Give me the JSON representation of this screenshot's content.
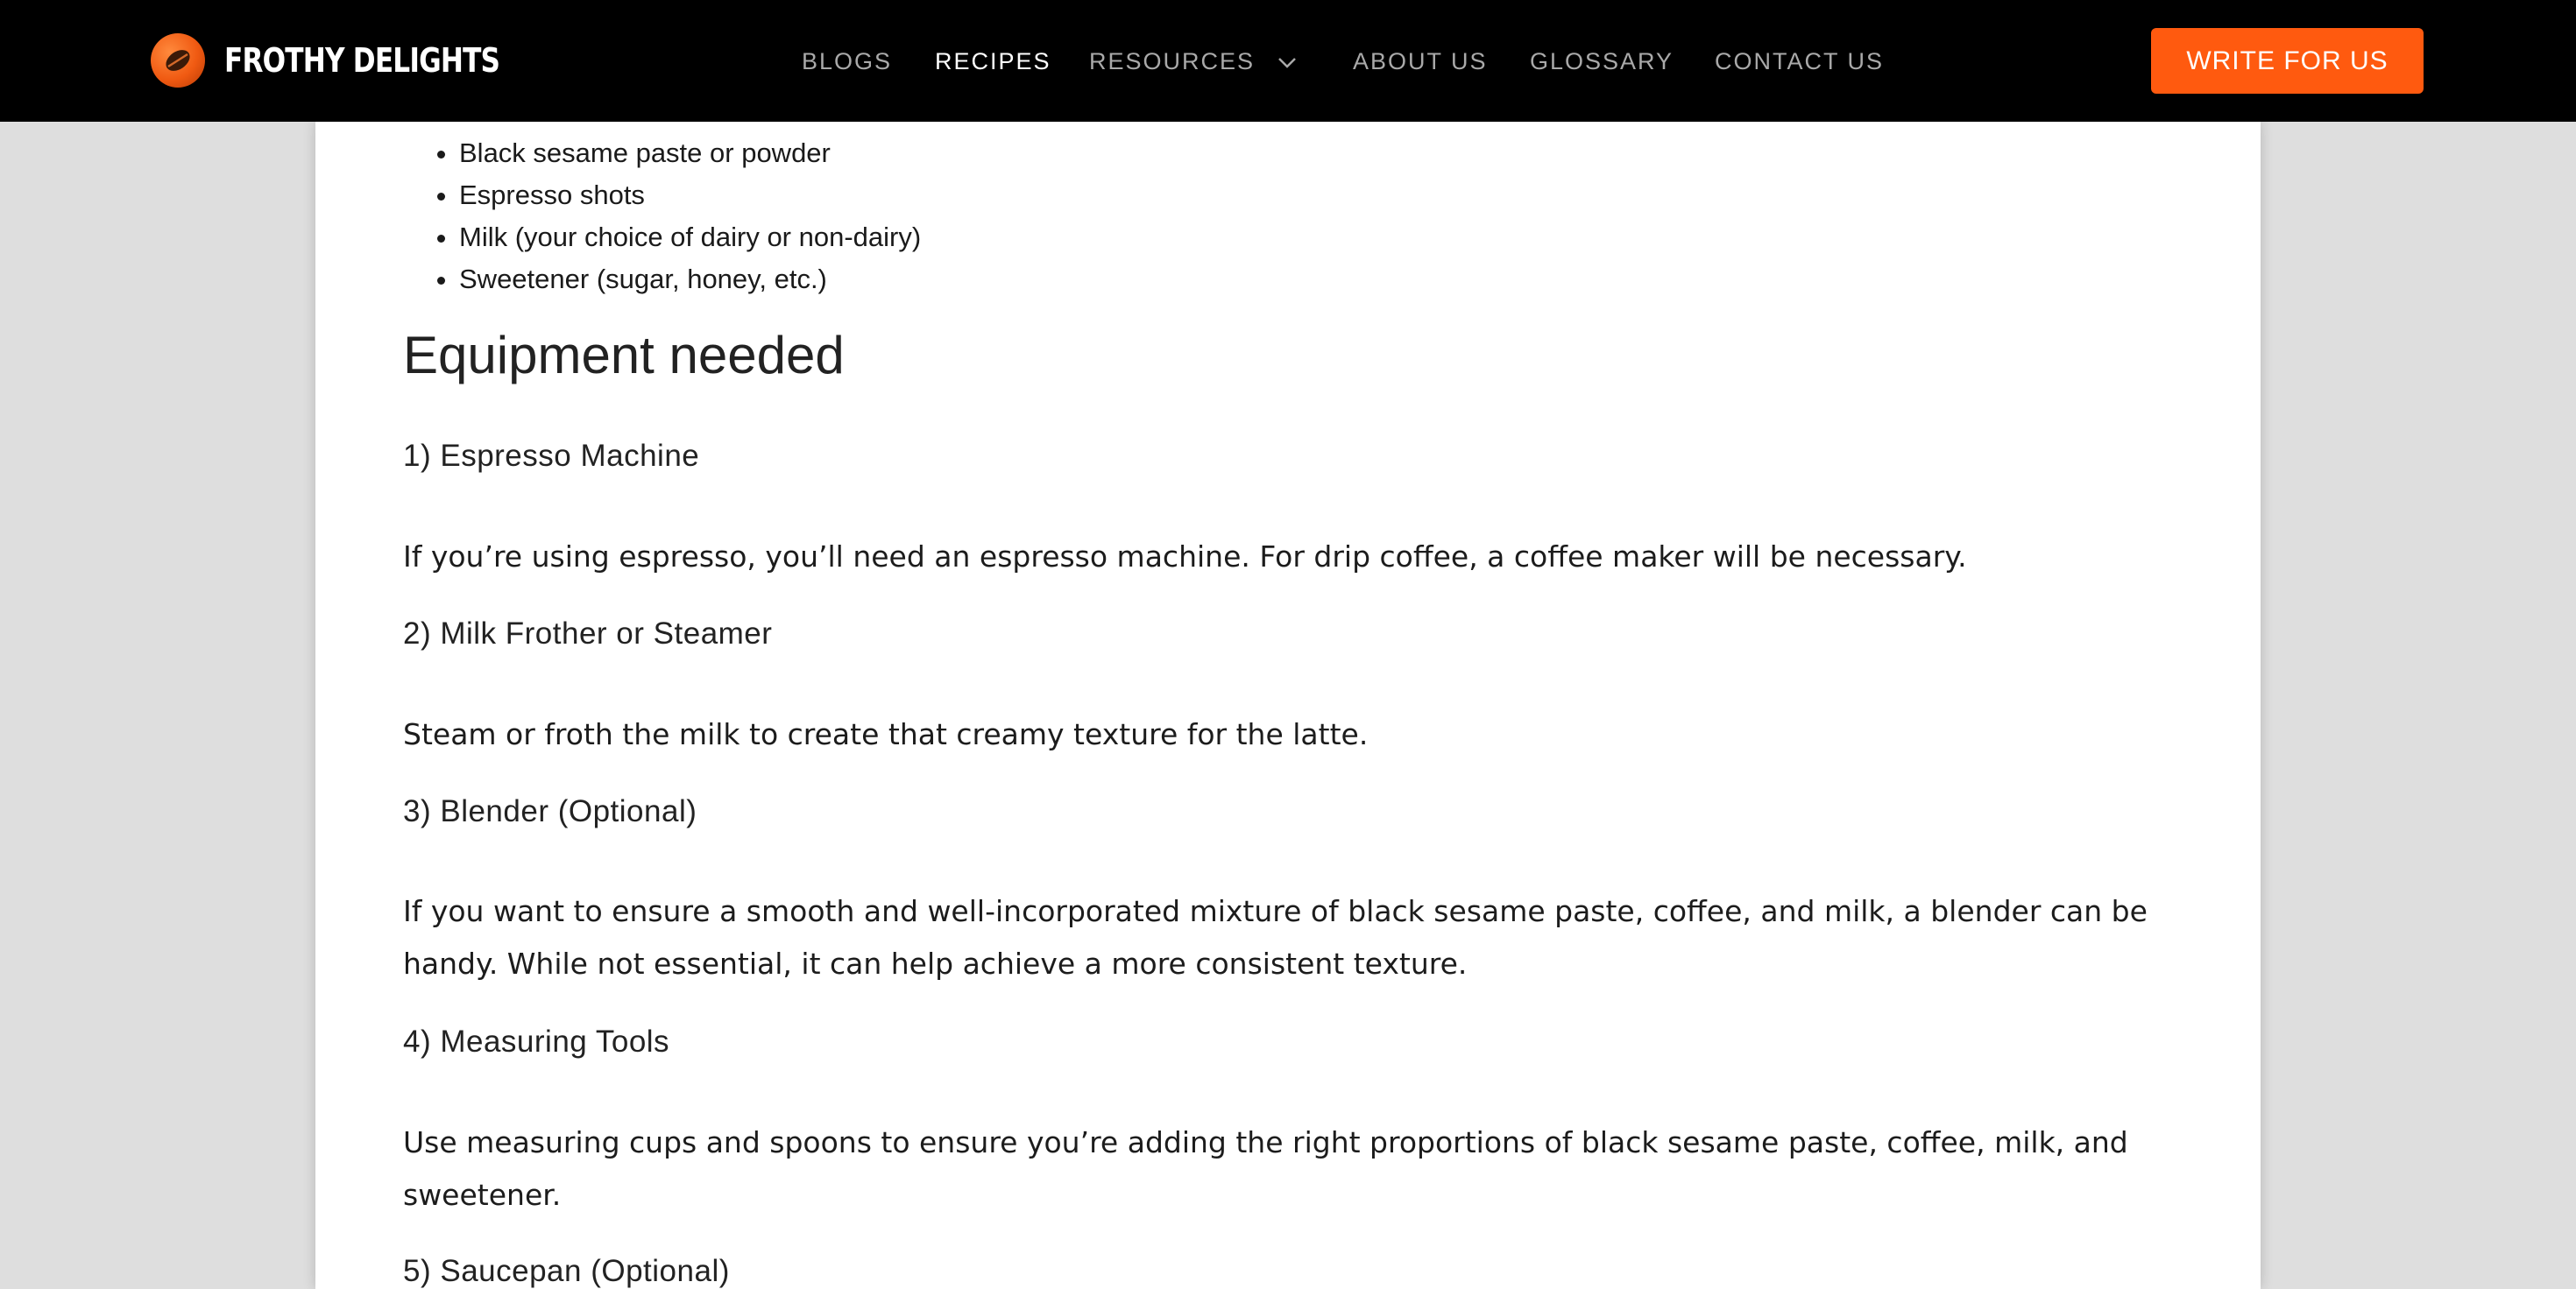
{
  "header": {
    "brand_name": "FROTHY DELIGHTS",
    "logo_icon": "coffee-bean-icon",
    "nav": [
      {
        "label": "BLOGS",
        "active": false
      },
      {
        "label": "RECIPES",
        "active": true
      },
      {
        "label": "RESOURCES",
        "active": false,
        "has_dropdown": true
      },
      {
        "label": "ABOUT US",
        "active": false
      },
      {
        "label": "GLOSSARY",
        "active": false
      },
      {
        "label": "CONTACT US",
        "active": false
      }
    ],
    "cta_label": "WRITE FOR US",
    "colors": {
      "bar": "#000000",
      "cta": "#ff5a0f",
      "nav_text": "#a9a9a9",
      "nav_active": "#ffffff"
    }
  },
  "article": {
    "ingredients": [
      "Black sesame paste or powder",
      "Espresso shots",
      "Milk (your choice of dairy or non-dairy)",
      "Sweetener (sugar, honey, etc.)"
    ],
    "section_title": "Equipment needed",
    "equipment": [
      {
        "heading": "1) Espresso Machine",
        "text": "If you’re using espresso, you’ll need an espresso machine. For drip coffee, a coffee maker will be necessary."
      },
      {
        "heading": "2) Milk Frother or Steamer",
        "text": "Steam or froth the milk to create that creamy texture for the latte."
      },
      {
        "heading": "3) Blender (Optional)",
        "text": "If you want to ensure a smooth and well-incorporated mixture of black sesame paste, coffee, and milk, a blender can be handy. While not essential, it can help achieve a more consistent texture."
      },
      {
        "heading": "4) Measuring Tools",
        "text": "Use measuring cups and spoons to ensure you’re adding the right proportions of black sesame paste, coffee, milk, and sweetener."
      },
      {
        "heading": "5) Saucepan (Optional)"
      }
    ]
  }
}
